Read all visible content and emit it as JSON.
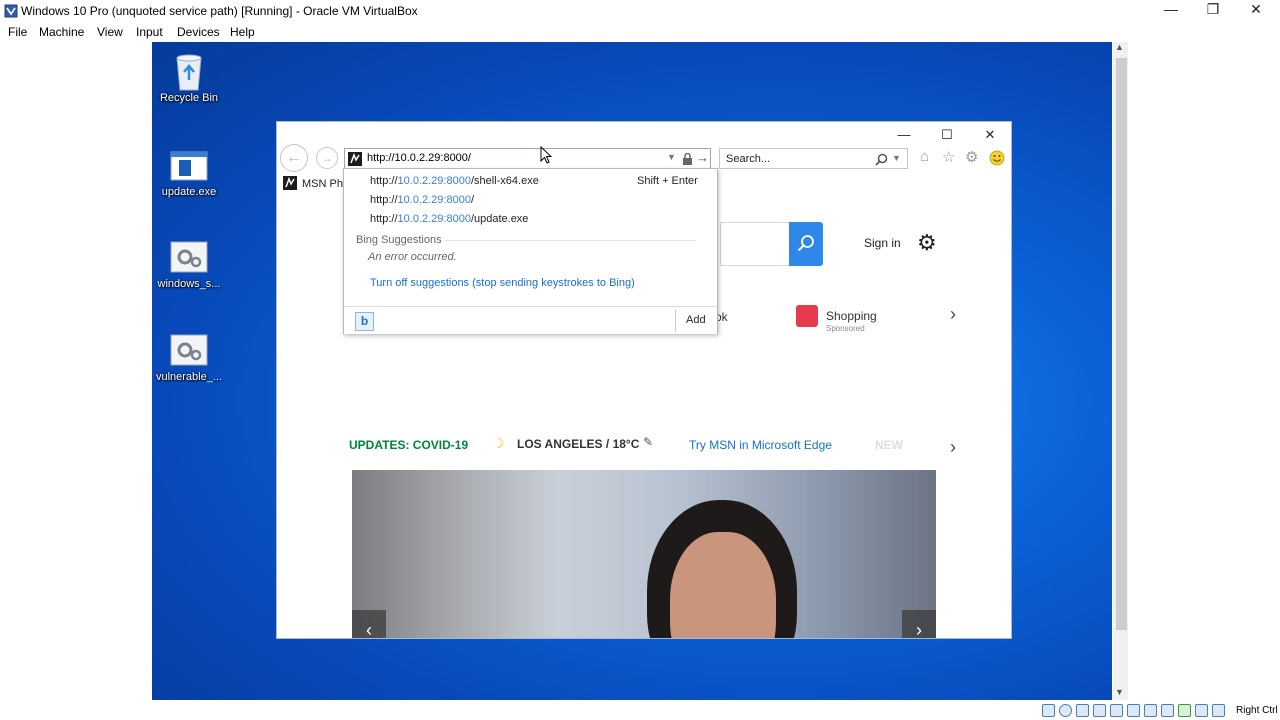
{
  "vbox": {
    "title": "Windows 10 Pro (unquoted service path) [Running] - Oracle VM VirtualBox",
    "menu": [
      "File",
      "Machine",
      "View",
      "Input",
      "Devices",
      "Help"
    ],
    "controls": {
      "minimize": "—",
      "restore": "❐",
      "close": "✕"
    },
    "host_key": "Right Ctrl"
  },
  "desktop": {
    "icons": [
      {
        "label": "Recycle Bin",
        "icon": "recycle-bin-icon"
      },
      {
        "label": "update.exe",
        "icon": "exe-window-icon"
      },
      {
        "label": "windows_s...",
        "icon": "gear-file-icon"
      },
      {
        "label": "vulnerable_...",
        "icon": "gear-file-icon"
      }
    ]
  },
  "ie": {
    "controls": {
      "minimize": "—",
      "maximize": "☐",
      "close": "✕"
    },
    "address_value": "http://10.0.2.29:8000/",
    "search_placeholder": "Search...",
    "tab_label": "MSN Phi",
    "toolbar_icons": [
      "home-icon",
      "favorites-star-icon",
      "settings-gear-icon",
      "smiley-feedback-icon"
    ]
  },
  "autocomplete": {
    "items": [
      {
        "prefix": "http://",
        "host": "10.0.2.29:8000",
        "path": "/shell-x64.exe"
      },
      {
        "prefix": "http://",
        "host": "10.0.2.29:8000",
        "path": "/"
      },
      {
        "prefix": "http://",
        "host": "10.0.2.29:8000",
        "path": "/update.exe"
      }
    ],
    "hint": "Shift + Enter",
    "bing_heading": "Bing Suggestions",
    "error": "An error occurred.",
    "turn_off": "Turn off suggestions (stop sending keystrokes to Bing)",
    "add_label": "Add",
    "bing_logo": "b"
  },
  "msn": {
    "signin": "Sign in",
    "partial_link": "ok",
    "shopping": "Shopping",
    "sponsored": "Sponsored",
    "covid": "UPDATES: COVID-19",
    "weather": "LOS ANGELES / 18°C",
    "edge_link": "Try MSN in Microsoft Edge",
    "news_fade": "NEW"
  },
  "colors": {
    "desktop_blue": "#0b63d8",
    "msn_search_blue": "#2f87e8",
    "covid_green": "#00843d",
    "link_blue": "#1a6fc9"
  }
}
